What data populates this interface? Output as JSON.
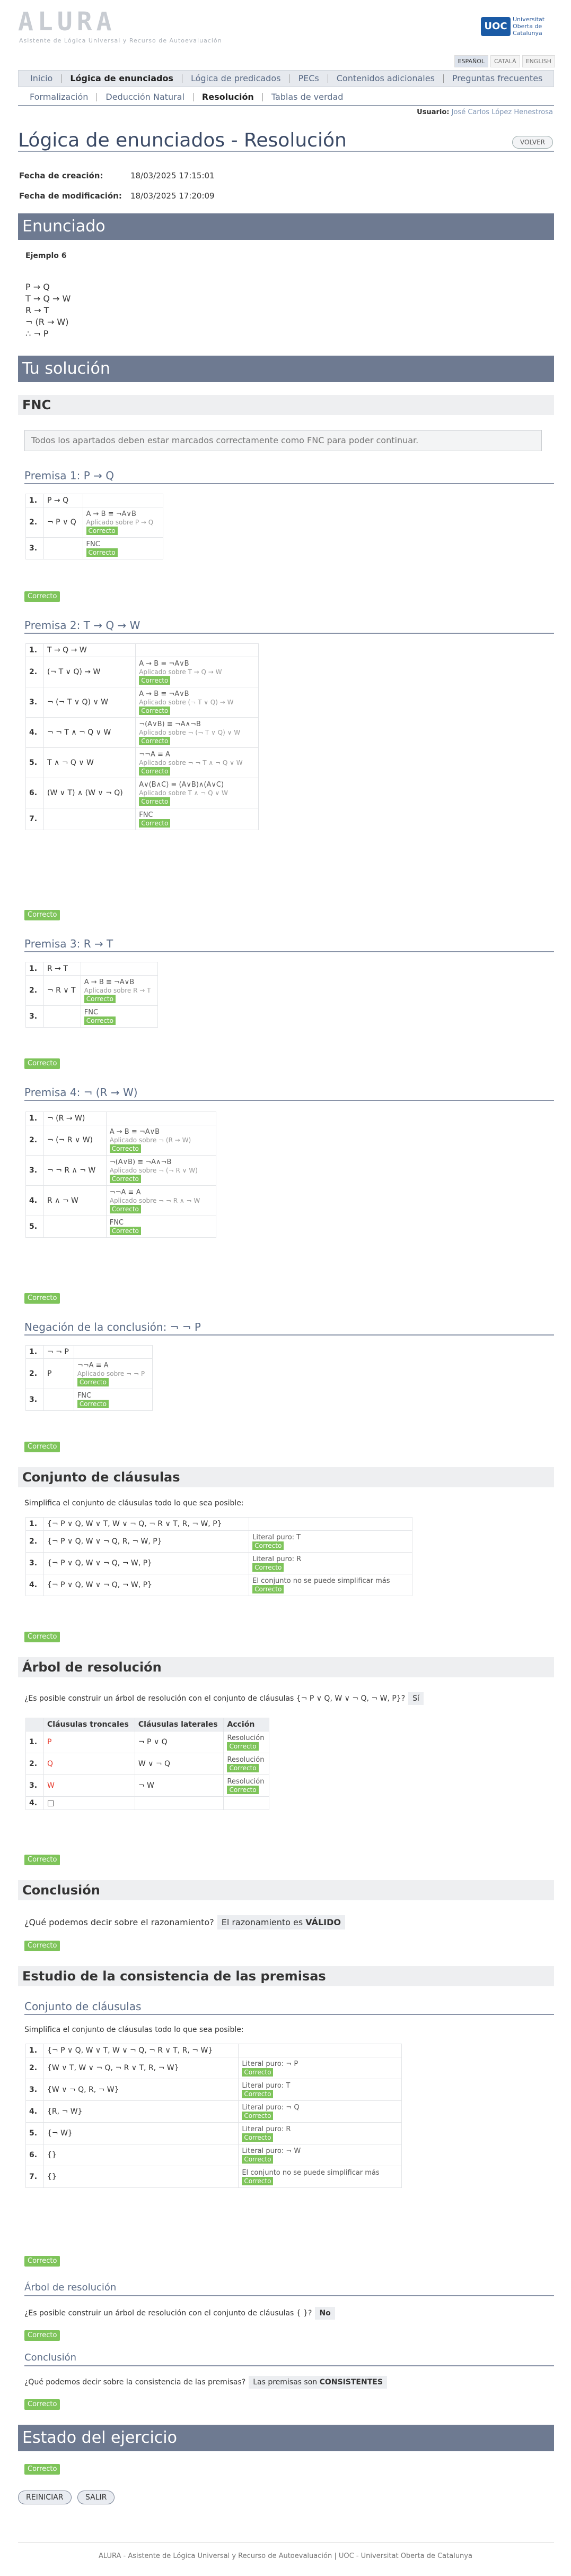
{
  "header": {
    "logo": "ALURA",
    "subtitle": "Asistente de Lógica Universal y Recurso de Autoevaluación",
    "uoc_mark": "UOC",
    "uoc_text": "Universitat Oberta de Catalunya"
  },
  "langs": [
    "ESPAÑOL",
    "CATALÀ",
    "ENGLISH"
  ],
  "nav1": [
    "Inicio",
    "Lógica de enunciados",
    "Lógica de predicados",
    "PECs",
    "Contenidos adicionales",
    "Preguntas frecuentes"
  ],
  "nav2": [
    "Formalización",
    "Deducción Natural",
    "Resolución",
    "Tablas de verdad"
  ],
  "user": {
    "label": "Usuario:",
    "name": "José Carlos López Henestrosa"
  },
  "title": "Lógica de enunciados - Resolución",
  "back": "VOLVER",
  "meta": {
    "created_label": "Fecha de creación:",
    "created": "18/03/2025 17:15:01",
    "modified_label": "Fecha de modificación:",
    "modified": "18/03/2025 17:20:09"
  },
  "enunciado": {
    "bar": "Enunciado",
    "example": "Ejemplo 6",
    "premises": [
      "P → Q",
      "T → Q → W",
      "R → T",
      "¬ (R → W)",
      "∴ ¬ P"
    ]
  },
  "sol": "Tu solución",
  "fnc": {
    "title": "FNC",
    "info": "Todos los apartados deben estar marcados correctamente como FNC para poder continuar."
  },
  "correct": "Correcto",
  "p1": {
    "title": "Premisa 1: P → Q",
    "rows": [
      [
        "1.",
        "P → Q",
        "",
        ""
      ],
      [
        "2.",
        "¬ P ∨ Q",
        "A → B ≡ ¬A∨B",
        "Aplicado sobre P → Q"
      ],
      [
        "3.",
        "",
        "FNC",
        ""
      ]
    ]
  },
  "p2": {
    "title": "Premisa 2: T → Q → W",
    "rows": [
      [
        "1.",
        "T → Q → W",
        "",
        ""
      ],
      [
        "2.",
        "(¬ T ∨ Q) → W",
        "A → B ≡ ¬A∨B",
        "Aplicado sobre T → Q → W"
      ],
      [
        "3.",
        "¬ (¬ T ∨ Q) ∨ W",
        "A → B ≡ ¬A∨B",
        "Aplicado sobre (¬ T ∨ Q) → W"
      ],
      [
        "4.",
        "¬ ¬ T ∧ ¬ Q ∨ W",
        "¬(A∨B) ≡ ¬A∧¬B",
        "Aplicado sobre ¬ (¬ T ∨ Q) ∨ W"
      ],
      [
        "5.",
        "T ∧ ¬ Q ∨ W",
        "¬¬A ≡ A",
        "Aplicado sobre ¬ ¬ T ∧ ¬ Q ∨ W"
      ],
      [
        "6.",
        "(W ∨ T) ∧ (W ∨ ¬ Q)",
        "A∨(B∧C) ≡ (A∨B)∧(A∨C)",
        "Aplicado sobre T ∧ ¬ Q ∨ W"
      ],
      [
        "7.",
        "",
        "FNC",
        ""
      ]
    ]
  },
  "p3": {
    "title": "Premisa 3: R → T",
    "rows": [
      [
        "1.",
        "R → T",
        "",
        ""
      ],
      [
        "2.",
        "¬ R ∨ T",
        "A → B ≡ ¬A∨B",
        "Aplicado sobre R → T"
      ],
      [
        "3.",
        "",
        "FNC",
        ""
      ]
    ]
  },
  "p4": {
    "title": "Premisa 4: ¬ (R → W)",
    "rows": [
      [
        "1.",
        "¬ (R → W)",
        "",
        ""
      ],
      [
        "2.",
        "¬ (¬ R ∨ W)",
        "A → B ≡ ¬A∨B",
        "Aplicado sobre ¬ (R → W)"
      ],
      [
        "3.",
        "¬ ¬ R ∧ ¬ W",
        "¬(A∨B) ≡ ¬A∧¬B",
        "Aplicado sobre ¬ (¬ R ∨ W)"
      ],
      [
        "4.",
        "R ∧ ¬ W",
        "¬¬A ≡ A",
        "Aplicado sobre ¬ ¬ R ∧ ¬ W"
      ],
      [
        "5.",
        "",
        "FNC",
        ""
      ]
    ]
  },
  "neg": {
    "title": "Negación de la conclusión: ¬ ¬ P",
    "rows": [
      [
        "1.",
        "¬ ¬ P",
        "",
        ""
      ],
      [
        "2.",
        "P",
        "¬¬A ≡ A",
        "Aplicado sobre ¬ ¬ P"
      ],
      [
        "3.",
        "",
        "FNC",
        ""
      ]
    ]
  },
  "cc": {
    "title": "Conjunto de cláusulas",
    "intro": "Simplifica el conjunto de cláusulas todo lo que sea posible:",
    "rows": [
      [
        "1.",
        "{¬ P ∨ Q, W ∨ T, W ∨ ¬ Q, ¬ R ∨ T, R, ¬ W, P}",
        ""
      ],
      [
        "2.",
        "{¬ P ∨ Q, W ∨ ¬ Q, R, ¬ W, P}",
        "Literal puro: T"
      ],
      [
        "3.",
        "{¬ P ∨ Q, W ∨ ¬ Q, ¬ W, P}",
        "Literal puro: R"
      ],
      [
        "4.",
        "{¬ P ∨ Q, W ∨ ¬ Q, ¬ W, P}",
        "El conjunto no se puede simplificar más"
      ]
    ]
  },
  "arbol": {
    "title": "Árbol de resolución",
    "q": "¿Es posible construir un árbol de resolución con el conjunto de cláusulas {¬ P ∨ Q, W ∨ ¬ Q, ¬ W, P}?",
    "a": "Sí",
    "headers": [
      "",
      "Cláusulas troncales",
      "Cláusulas laterales",
      "Acción"
    ],
    "rows": [
      [
        "1.",
        "P",
        "¬ P ∨ Q",
        "Resolución"
      ],
      [
        "2.",
        "Q",
        "W ∨ ¬ Q",
        "Resolución"
      ],
      [
        "3.",
        "W",
        "¬ W",
        "Resolución"
      ],
      [
        "4.",
        "□",
        "",
        ""
      ]
    ]
  },
  "concl": {
    "title": "Conclusión",
    "q": "¿Qué podemos decir sobre el razonamiento?",
    "a1": "El razonamiento es ",
    "a2": "VÁLIDO"
  },
  "cons": {
    "title": "Estudio de la consistencia de las premisas",
    "sub1": "Conjunto de cláusulas",
    "intro": "Simplifica el conjunto de cláusulas todo lo que sea posible:",
    "rows": [
      [
        "1.",
        "{¬ P ∨ Q, W ∨ T, W ∨ ¬ Q, ¬ R ∨ T, R, ¬ W}",
        ""
      ],
      [
        "2.",
        "{W ∨ T, W ∨ ¬ Q, ¬ R ∨ T, R, ¬ W}",
        "Literal puro: ¬ P"
      ],
      [
        "3.",
        "{W ∨ ¬ Q, R, ¬ W}",
        "Literal puro: T"
      ],
      [
        "4.",
        "{R, ¬ W}",
        "Literal puro: ¬ Q"
      ],
      [
        "5.",
        "{¬ W}",
        "Literal puro: R"
      ],
      [
        "6.",
        "{}",
        "Literal puro: ¬ W"
      ],
      [
        "7.",
        "{}",
        "El conjunto no se puede simplificar más"
      ]
    ],
    "sub2": "Árbol de resolución",
    "q2": "¿Es posible construir un árbol de resolución con el conjunto de cláusulas { }?",
    "a2": "No",
    "sub3": "Conclusión",
    "q3": "¿Qué podemos decir sobre la consistencia de las premisas?",
    "a3a": "Las premisas son ",
    "a3b": "CONSISTENTES"
  },
  "estado": {
    "title": "Estado del ejercicio"
  },
  "buttons": {
    "reset": "REINICIAR",
    "exit": "SALIR"
  },
  "footer": "ALURA - Asistente de Lógica Universal y Recurso de Autoevaluación | UOC - Universitat Oberta de Catalunya"
}
